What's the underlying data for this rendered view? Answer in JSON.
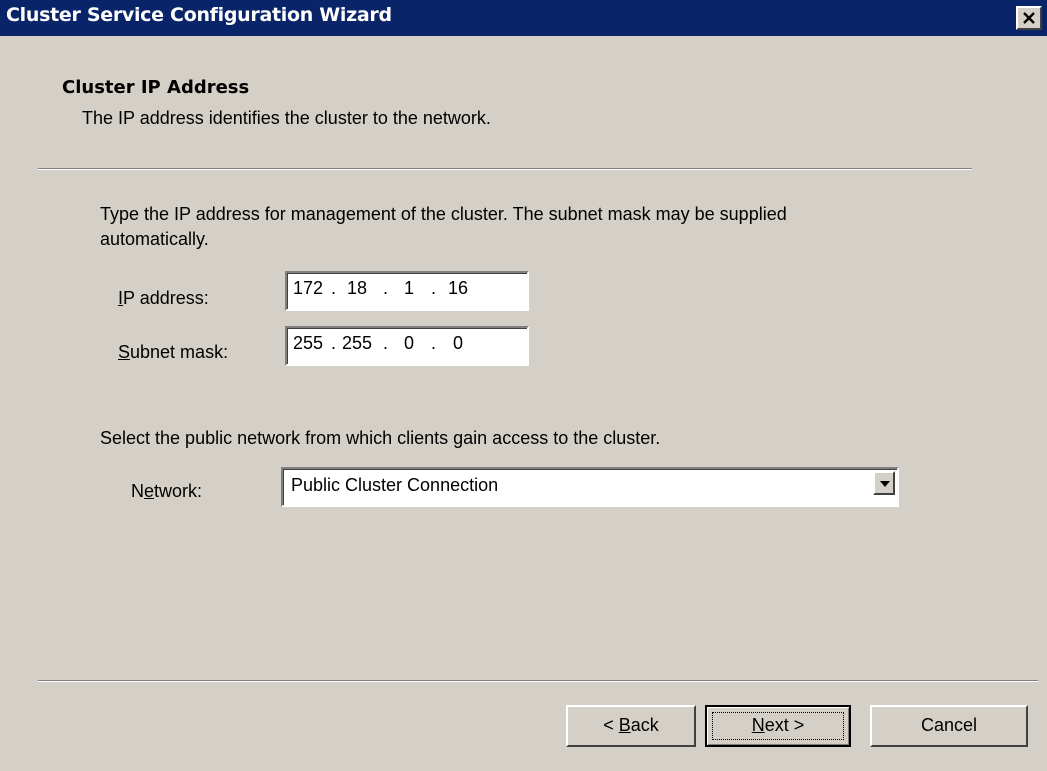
{
  "window": {
    "title": "Cluster Service Configuration Wizard"
  },
  "header": {
    "title": "Cluster IP Address",
    "subtitle": "The IP address identifies the cluster to the network."
  },
  "main": {
    "instructions_line1": "Type the IP address for management of the cluster. The subnet mask may be supplied",
    "instructions_line2": "automatically.",
    "ip_address": {
      "label_accel": "I",
      "label_rest": "P address:",
      "octets": [
        "172",
        "18",
        "1",
        "16"
      ]
    },
    "subnet_mask": {
      "label_accel": "S",
      "label_rest": "ubnet mask:",
      "octets": [
        "255",
        "255",
        "0",
        "0"
      ]
    },
    "network_instructions": "Select the public network from which clients gain access to the cluster.",
    "network": {
      "label_pre": "N",
      "label_accel": "e",
      "label_rest": "twork:",
      "selected": "Public Cluster Connection"
    }
  },
  "footer": {
    "back": {
      "pre": "< ",
      "accel": "B",
      "rest": "ack"
    },
    "next": {
      "accel": "N",
      "rest": "ext >"
    },
    "cancel": "Cancel"
  },
  "icons": {
    "close": "close-icon",
    "dropdown": "chevron-down-icon"
  }
}
